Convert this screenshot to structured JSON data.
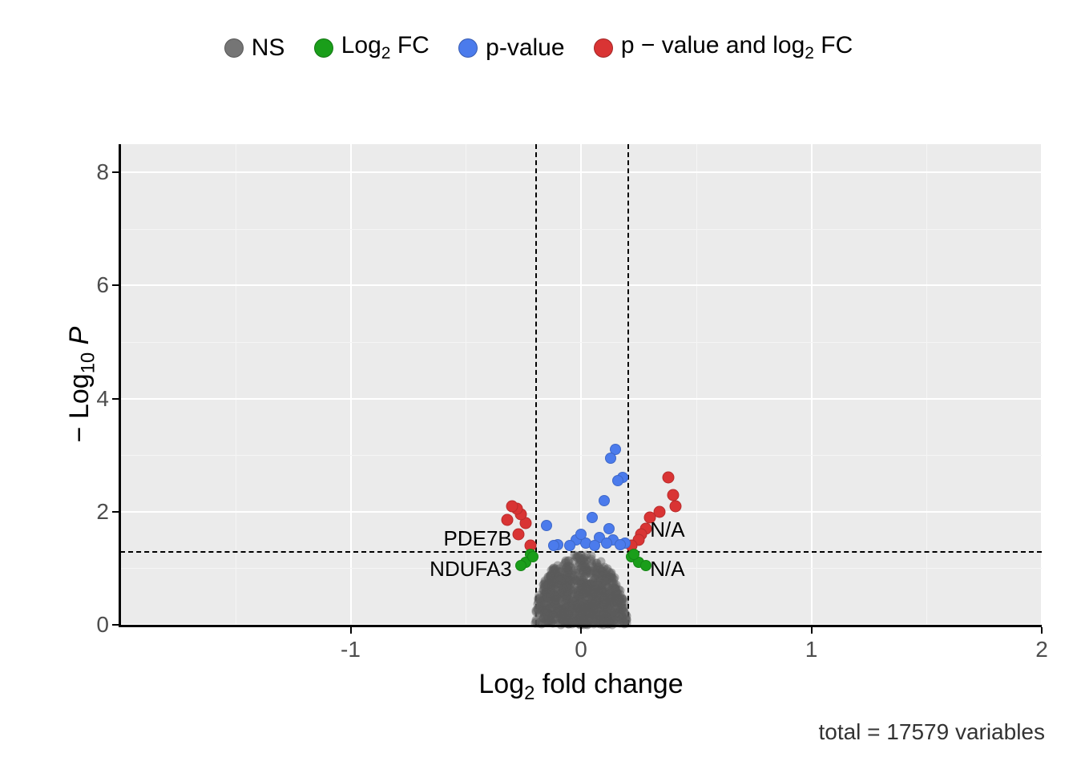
{
  "chart_data": {
    "type": "scatter",
    "subtype": "volcano",
    "xlabel_html": "Log<sub>2</sub> fold change",
    "ylabel_html": "&minus; Log<sub>10</sub> <i>P</i>",
    "xlim": [
      -2,
      2
    ],
    "ylim": [
      0,
      8.5
    ],
    "x_ticks": [
      -1,
      0,
      1,
      2
    ],
    "y_ticks": [
      0,
      2,
      4,
      6,
      8
    ],
    "thresholds": {
      "log2fc_neg": -0.2,
      "log2fc_pos": 0.2,
      "neglog10p": 1.3
    },
    "caption": "total = 17579 variables",
    "legend": [
      {
        "label": "NS",
        "color": "#757575"
      },
      {
        "label_html": "Log<sub>2</sub> FC",
        "color": "#1a9e1a"
      },
      {
        "label": "p-value",
        "color": "#4b7bec"
      },
      {
        "label_html": "p &minus; value and log<sub>2</sub> FC",
        "color": "#d93434"
      }
    ],
    "annotations": [
      {
        "text": "PDE7B",
        "x": -0.3,
        "y": 1.55
      },
      {
        "text": "NDUFA3",
        "x": -0.3,
        "y": 1.0
      },
      {
        "text": "N/A",
        "x": 0.3,
        "y": 1.7
      },
      {
        "text": "N/A",
        "x": 0.3,
        "y": 1.0
      }
    ],
    "series": [
      {
        "name": "p-value and log2 FC",
        "class": "both",
        "points": [
          {
            "x": 0.4,
            "y": 2.3
          },
          {
            "x": 0.41,
            "y": 2.1
          },
          {
            "x": 0.38,
            "y": 2.6
          },
          {
            "x": 0.34,
            "y": 2.0
          },
          {
            "x": 0.3,
            "y": 1.9
          },
          {
            "x": 0.28,
            "y": 1.7
          },
          {
            "x": 0.26,
            "y": 1.6
          },
          {
            "x": 0.25,
            "y": 1.5
          },
          {
            "x": 0.22,
            "y": 1.4
          },
          {
            "x": -0.24,
            "y": 1.8
          },
          {
            "x": -0.26,
            "y": 1.95
          },
          {
            "x": -0.28,
            "y": 2.05
          },
          {
            "x": -0.3,
            "y": 2.1
          },
          {
            "x": -0.27,
            "y": 1.6
          },
          {
            "x": -0.22,
            "y": 1.4
          },
          {
            "x": -0.32,
            "y": 1.85
          }
        ]
      },
      {
        "name": "p-value",
        "class": "pv",
        "points": [
          {
            "x": 0.15,
            "y": 3.1
          },
          {
            "x": 0.13,
            "y": 2.95
          },
          {
            "x": 0.18,
            "y": 2.6
          },
          {
            "x": 0.16,
            "y": 2.55
          },
          {
            "x": 0.1,
            "y": 2.2
          },
          {
            "x": 0.05,
            "y": 1.9
          },
          {
            "x": 0.12,
            "y": 1.7
          },
          {
            "x": 0.08,
            "y": 1.55
          },
          {
            "x": 0.02,
            "y": 1.45
          },
          {
            "x": -0.02,
            "y": 1.5
          },
          {
            "x": -0.05,
            "y": 1.4
          },
          {
            "x": -0.1,
            "y": 1.42
          },
          {
            "x": -0.15,
            "y": 1.75
          },
          {
            "x": 0.19,
            "y": 1.45
          },
          {
            "x": 0.06,
            "y": 1.4
          },
          {
            "x": 0.0,
            "y": 1.6
          },
          {
            "x": 0.14,
            "y": 1.5
          },
          {
            "x": 0.11,
            "y": 1.45
          },
          {
            "x": 0.17,
            "y": 1.42
          },
          {
            "x": -0.12,
            "y": 1.4
          }
        ]
      },
      {
        "name": "Log2 FC",
        "class": "fc",
        "points": [
          {
            "x": 0.22,
            "y": 1.2
          },
          {
            "x": 0.25,
            "y": 1.1
          },
          {
            "x": 0.23,
            "y": 1.25
          },
          {
            "x": 0.28,
            "y": 1.05
          },
          {
            "x": -0.22,
            "y": 1.25
          },
          {
            "x": -0.24,
            "y": 1.1
          },
          {
            "x": -0.21,
            "y": 1.2
          },
          {
            "x": -0.26,
            "y": 1.05
          }
        ]
      }
    ],
    "ns_cluster": {
      "count_approx": 17500,
      "x_range": [
        -0.2,
        0.2
      ],
      "y_range": [
        0.0,
        1.3
      ]
    }
  }
}
